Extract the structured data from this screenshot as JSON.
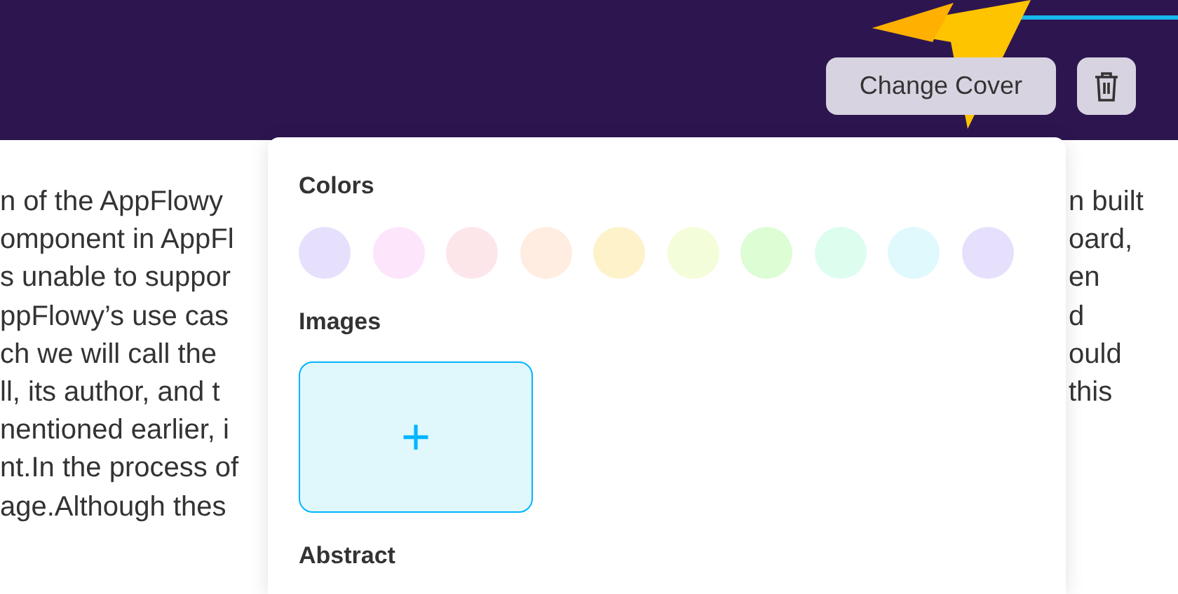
{
  "header": {
    "buttons": [
      {
        "kind": "text",
        "label": "Change Cover"
      },
      {
        "kind": "delete"
      }
    ]
  },
  "document": {
    "lines": [
      {
        "left": "n of the AppFlowy",
        "right": "n built"
      },
      {
        "left": "omponent in AppFl",
        "right": "oard,"
      },
      {
        "left": "s unable to suppor",
        "right": "en"
      },
      {
        "left": "ppFlowy’s use cas",
        "right": "d"
      },
      {
        "left": "ch we will call the",
        "right": "ould"
      },
      {
        "left": "ll, its author, and t",
        "right": "this"
      },
      {
        "left": "nentioned earlier, i"
      },
      {
        "left": "nt.In the process of"
      },
      {
        "left": "age.Although thes"
      }
    ]
  },
  "cover_popover": {
    "colors_title": "Colors",
    "colors": [
      {
        "color": "#e6e0fd"
      },
      {
        "color": "#fde5fc"
      },
      {
        "color": "#fde6ea"
      },
      {
        "color": "#feede0"
      },
      {
        "color": "#fef2cb"
      },
      {
        "color": "#f4fdd9"
      },
      {
        "color": "#ddfdd5"
      },
      {
        "color": "#ddfdef"
      },
      {
        "color": "#e0f9fd"
      },
      {
        "color": "#e6e0fd"
      }
    ],
    "images_title": "Images",
    "add_image": "+",
    "abstract_title": "Abstract"
  }
}
